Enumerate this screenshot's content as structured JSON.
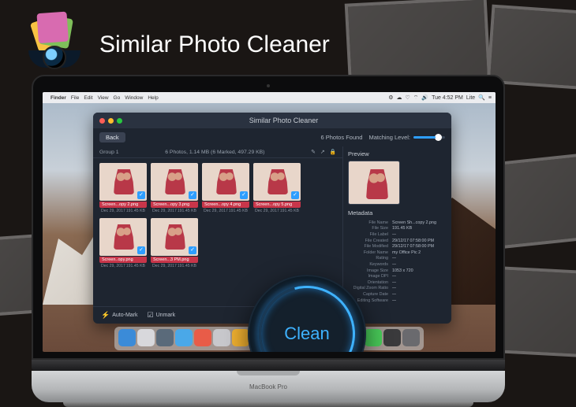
{
  "brand": {
    "title": "Similar Photo Cleaner"
  },
  "menubar": {
    "app": "Finder",
    "items": [
      "File",
      "Edit",
      "View",
      "Go",
      "Window",
      "Help"
    ],
    "status": {
      "time": "Tue 4:52 PM",
      "user": "Lite"
    }
  },
  "app": {
    "title": "Similar Photo Cleaner",
    "back": "Back",
    "found": "6 Photos Found",
    "matching_label": "Matching Level:",
    "group": {
      "name": "Group 1",
      "summary": "6 Photos, 1.14 MB (6 Marked, 497.29 KB)"
    },
    "thumbs": [
      {
        "name": "Screen...opy 2.png",
        "date": "Dec 29, 2017",
        "size": "191.45 KB",
        "checked": true
      },
      {
        "name": "Screen...opy 3.png",
        "date": "Dec 29, 2017",
        "size": "191.45 KB",
        "checked": true
      },
      {
        "name": "Screen...opy 4.png",
        "date": "Dec 29, 2017",
        "size": "191.45 KB",
        "checked": true
      },
      {
        "name": "Screen...opy 5.png",
        "date": "Dec 29, 2017",
        "size": "191.45 KB",
        "checked": true
      },
      {
        "name": "Screen..opy.png",
        "date": "Dec 29, 2017",
        "size": "191.45 KB",
        "checked": true
      },
      {
        "name": "Screen...3 PM.png",
        "date": "Dec 29, 2017",
        "size": "191.45 KB",
        "checked": true
      }
    ],
    "automark": "Auto-Mark",
    "unmark": "Unmark",
    "preview_label": "Preview",
    "metadata_label": "Metadata",
    "metadata": [
      {
        "label": "File Name",
        "value": "Screen Sh...copy 2.png"
      },
      {
        "label": "File Size",
        "value": "191.45 KB"
      },
      {
        "label": "File Label",
        "value": "—"
      },
      {
        "label": "File Created",
        "value": "29/12/17 07:58:00 PM"
      },
      {
        "label": "File Modified",
        "value": "29/12/17 07:58:00 PM"
      },
      {
        "label": "Folder Name",
        "value": "my Office Pic 2"
      },
      {
        "label": "Rating",
        "value": "—"
      },
      {
        "label": "Keywords",
        "value": "—"
      },
      {
        "label": "Image Size",
        "value": "1053 x 720"
      },
      {
        "label": "Image DPI",
        "value": "—"
      },
      {
        "label": "Orientation",
        "value": "—"
      },
      {
        "label": "Digital Zoom Ratio",
        "value": "—"
      },
      {
        "label": "Capture Date",
        "value": "—"
      },
      {
        "label": "Editing Software",
        "value": "—"
      }
    ],
    "clean": "Clean"
  },
  "laptop": {
    "model": "MacBook Pro"
  },
  "dock_colors": [
    "#3b8bd8",
    "#d8d8dc",
    "#5a6a7a",
    "#4aa8e8",
    "#e85c48",
    "#c8c8cc",
    "#f0b030",
    "#e8e8ec",
    "#d84838",
    "#b0b0b4",
    "#30a8f0",
    "#2866c8",
    "#30b858",
    "#48c858",
    "#3a3a3c",
    "#6a6a6e"
  ]
}
